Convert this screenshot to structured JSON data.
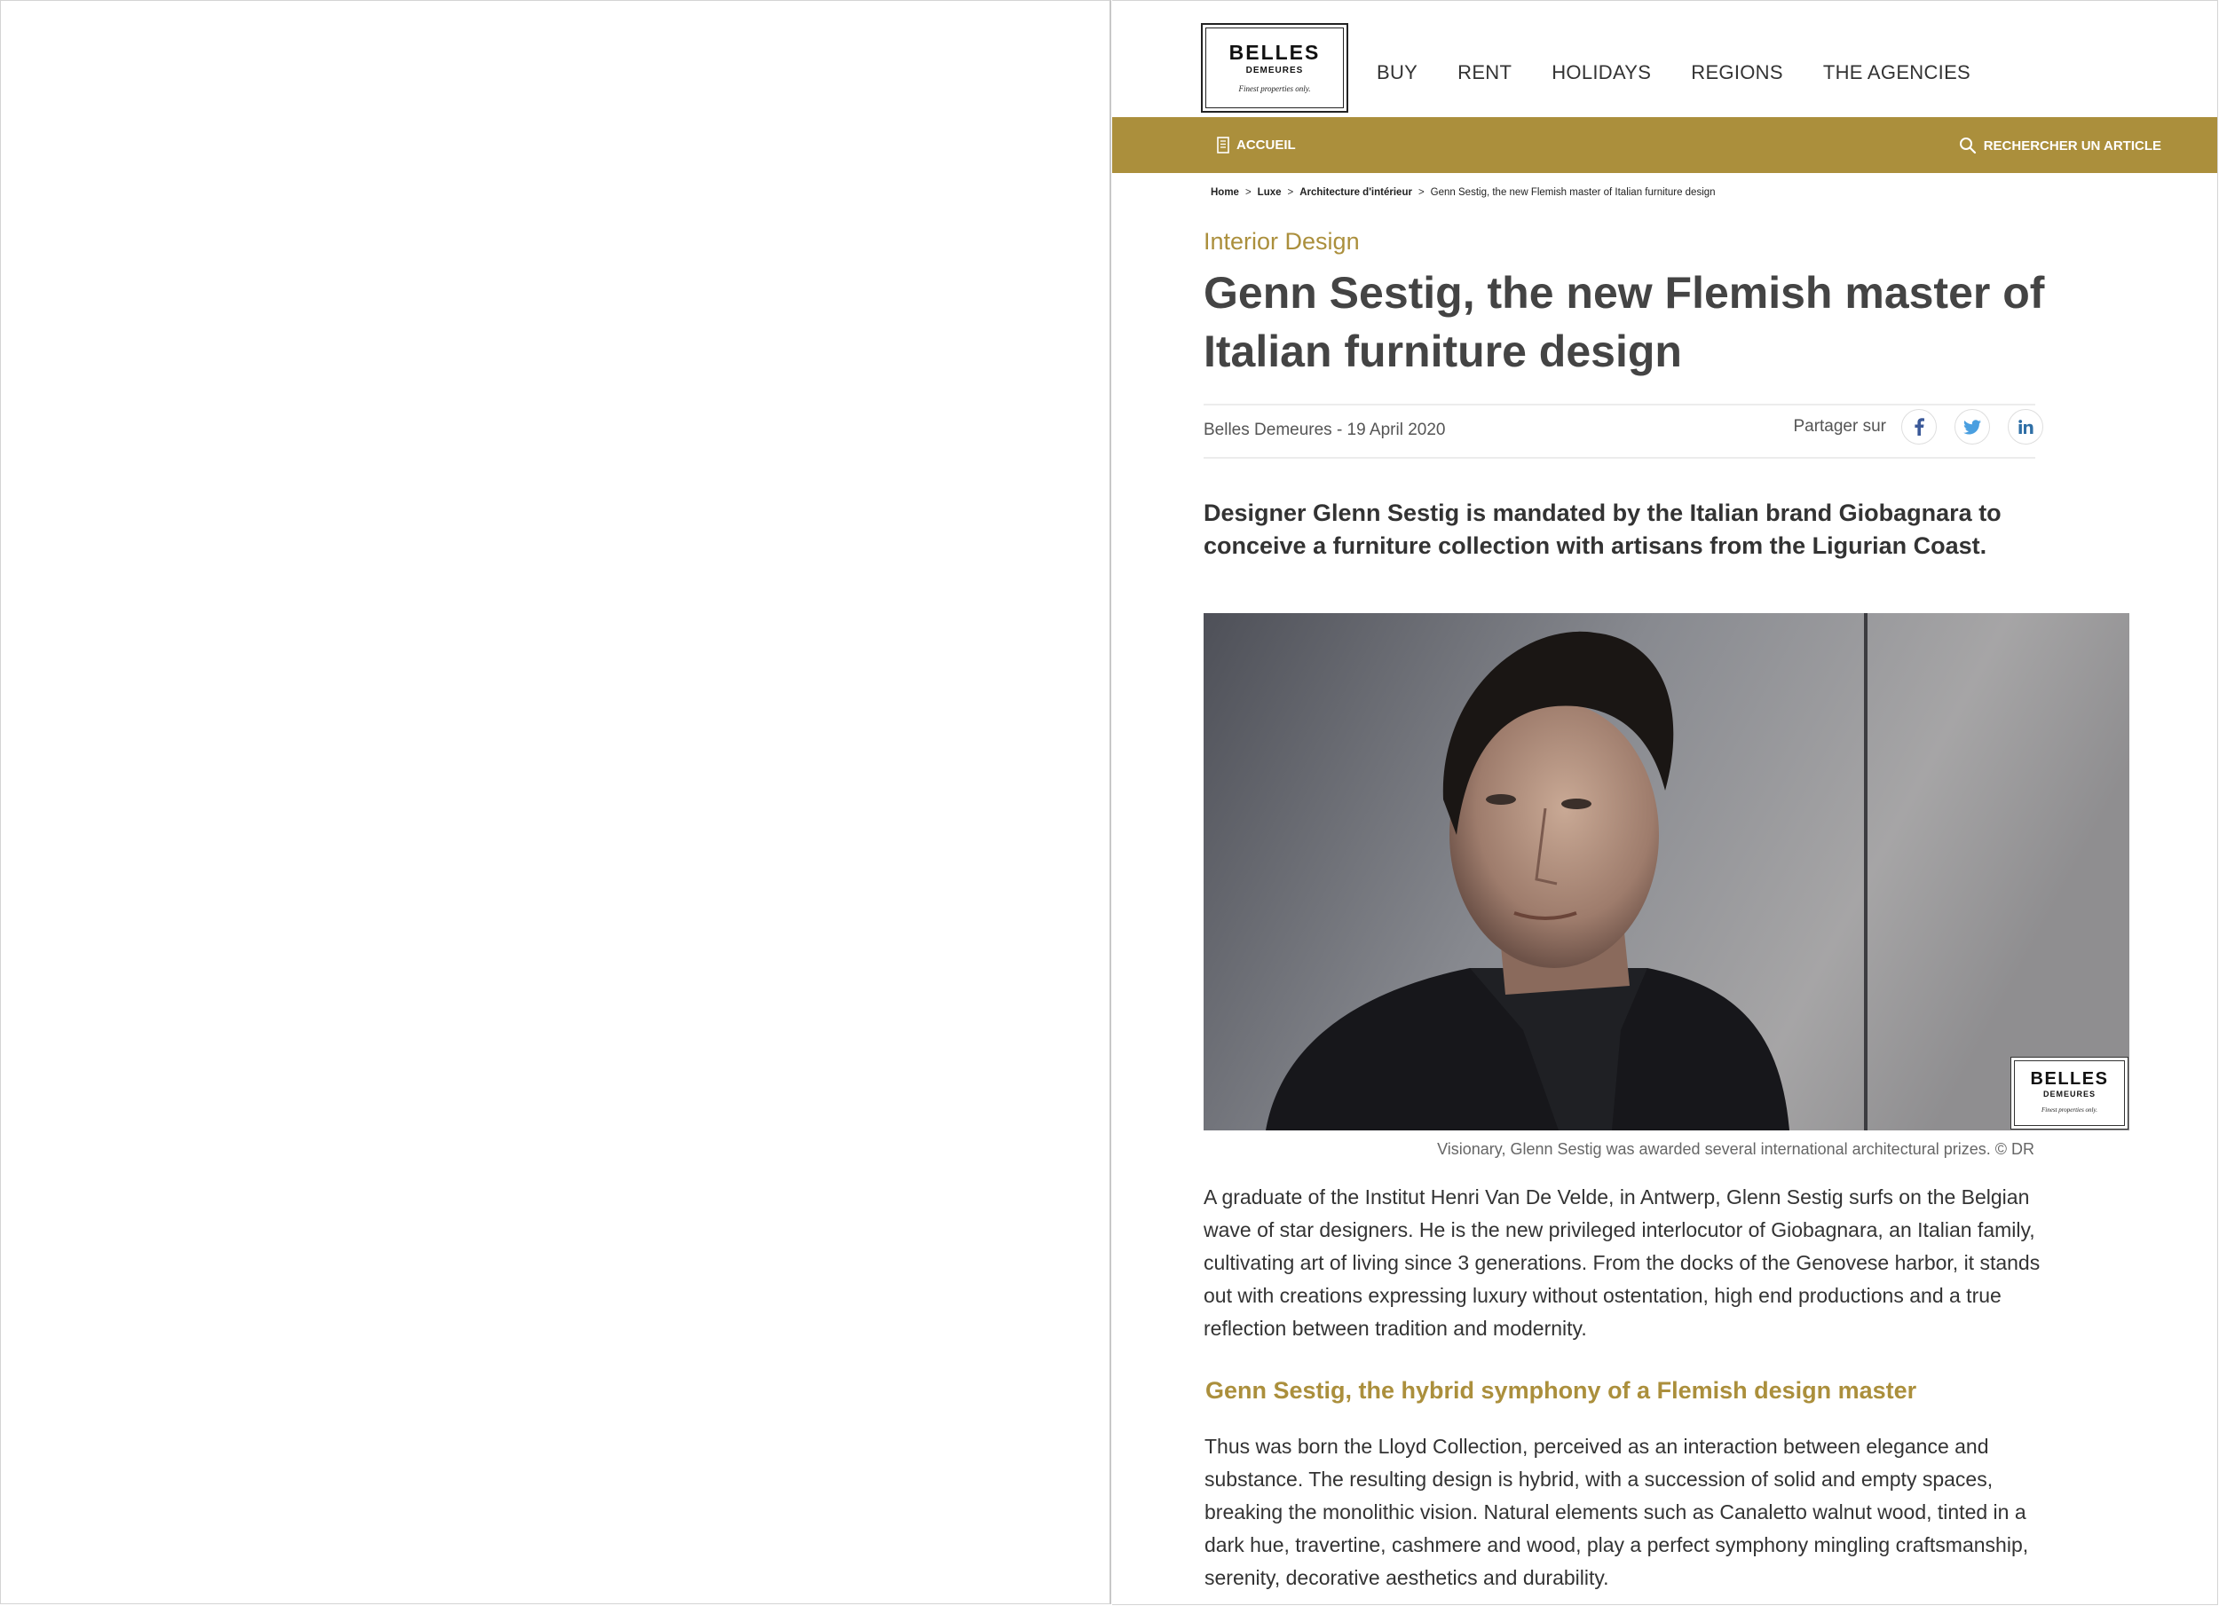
{
  "header": {
    "logo": {
      "line1": "BELLES",
      "line2": "DEMEURES",
      "tagline": "Finest properties only."
    },
    "nav": [
      "BUY",
      "RENT",
      "HOLIDAYS",
      "REGIONS",
      "THE AGENCIES"
    ]
  },
  "subbar": {
    "home_label": "ACCUEIL",
    "search_label": "RECHERCHER UN ARTICLE",
    "color": "#ab8f3c"
  },
  "breadcrumb": {
    "items": [
      "Home",
      "Luxe",
      "Architecture d'intérieur"
    ],
    "current": "Genn Sestig, the new Flemish master of Italian furniture design"
  },
  "article": {
    "category": "Interior Design",
    "title_line1": "Genn Sestig, the new Flemish master of",
    "title_line2": "Italian furniture design",
    "byline": "Belles Demeures - 19 April 2020",
    "share_label": "Partager sur",
    "share_icons": [
      "facebook-icon",
      "twitter-icon",
      "linkedin-icon"
    ],
    "lead": "Designer Glenn Sestig is mandated by the Italian brand Giobagnara to conceive a furniture collection with artisans from the Ligurian Coast.",
    "photo_watermark": {
      "line1": "BELLES",
      "line2": "DEMEURES",
      "tagline": "Finest properties only."
    },
    "caption": "Visionary, Glenn Sestig was awarded several international architectural prizes. © DR",
    "paragraph1": "A graduate of the Institut Henri Van De Velde, in Antwerp, Glenn Sestig surfs on the Belgian wave of star designers. He is the new privileged interlocutor of Giobagnara, an Italian family, cultivating art of living since 3 generations. From the docks of the Genovese harbor, it stands out with creations expressing luxury without ostentation, high end productions and a true reflection between tradition and modernity.",
    "subheading": "Genn Sestig, the hybrid symphony of a Flemish design master",
    "paragraph2": "Thus was born the Lloyd Collection, perceived as an interaction between elegance and substance. The resulting design is hybrid, with a succession of solid and empty spaces, breaking the monolithic vision. Natural elements such as Canaletto walnut wood, tinted in a dark hue, travertine, cashmere and wood, play a perfect symphony mingling craftsmanship, serenity, decorative aesthetics and durability."
  }
}
